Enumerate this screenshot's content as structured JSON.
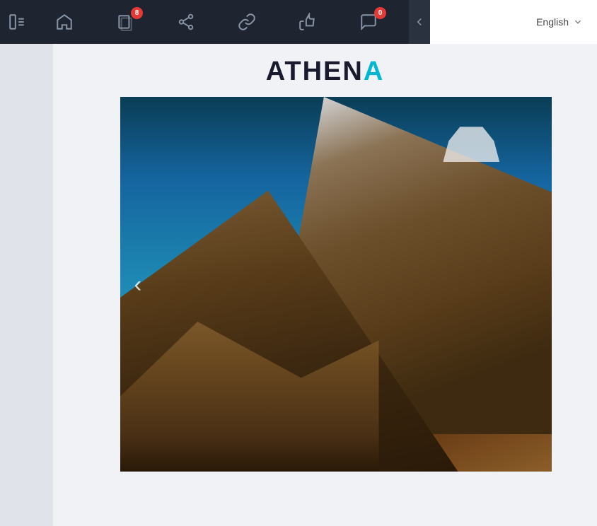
{
  "topbar": {
    "toggle_label": "sidebar-toggle",
    "nav_items": [
      {
        "id": "home",
        "icon": "home-icon",
        "badge": null
      },
      {
        "id": "files",
        "icon": "files-icon",
        "badge": "8"
      },
      {
        "id": "share",
        "icon": "share-icon",
        "badge": null
      },
      {
        "id": "link",
        "icon": "link-icon",
        "badge": null
      },
      {
        "id": "like",
        "icon": "like-icon",
        "badge": null
      },
      {
        "id": "chat",
        "icon": "chat-icon",
        "badge": "0"
      }
    ],
    "collapse_icon": "chevron-left-icon"
  },
  "langbar": {
    "label_prefix": "",
    "language": "English",
    "chevron_icon": "chevron-down-icon"
  },
  "logo": {
    "text_main": "ATHEN",
    "text_accent": "A"
  },
  "hero": {
    "prev_arrow": "‹",
    "alt_text": "Mountain landscape with blue sky"
  }
}
